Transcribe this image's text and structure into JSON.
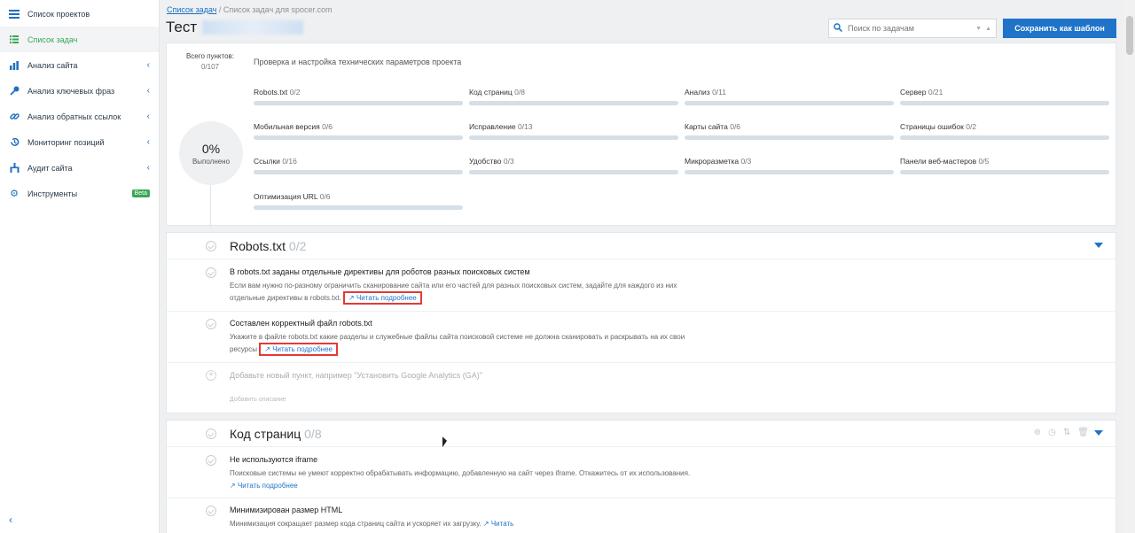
{
  "sidebar": {
    "items": [
      {
        "label": "Список проектов",
        "icon": "menu-icon"
      },
      {
        "label": "Список задач",
        "icon": "list-icon"
      },
      {
        "label": "Анализ сайта",
        "icon": "analysis-icon"
      },
      {
        "label": "Анализ ключевых фраз",
        "icon": "key-icon"
      },
      {
        "label": "Анализ обратных ссылок",
        "icon": "link-icon"
      },
      {
        "label": "Мониторинг позиций",
        "icon": "history-icon"
      },
      {
        "label": "Аудит сайта",
        "icon": "hierarchy-icon"
      },
      {
        "label": "Инструменты",
        "icon": "gear-icon"
      }
    ],
    "beta": "Beta",
    "active_color": "#3aa757"
  },
  "breadcrumb": {
    "link": "Список задач",
    "rest": " / Список задач для spocer.com"
  },
  "page_title": "Тест",
  "search": {
    "placeholder": "Поиск по задачам"
  },
  "save_button": "Сохранить как шаблон",
  "summary": {
    "total_label": "Всего пунктов:",
    "total_count": "0/107",
    "description": "Проверка и настройка технических параметров проекта",
    "percent": "0%",
    "done_label": "Выполнено",
    "categories": [
      {
        "name": "Robots.txt",
        "count": "0/2"
      },
      {
        "name": "Код страниц",
        "count": "0/8"
      },
      {
        "name": "Анализ",
        "count": "0/11"
      },
      {
        "name": "Сервер",
        "count": "0/21"
      },
      {
        "name": "Мобильная версия",
        "count": "0/6"
      },
      {
        "name": "Исправление",
        "count": "0/13"
      },
      {
        "name": "Карты сайта",
        "count": "0/6"
      },
      {
        "name": "Страницы ошибок",
        "count": "0/2"
      },
      {
        "name": "Ссылки",
        "count": "0/16"
      },
      {
        "name": "Удобство",
        "count": "0/3"
      },
      {
        "name": "Микроразметка",
        "count": "0/3"
      },
      {
        "name": "Панели веб-мастеров",
        "count": "0/5"
      },
      {
        "name": "Оптимизация URL",
        "count": "0/6"
      }
    ]
  },
  "robots": {
    "title": "Robots.txt",
    "count": "0/2",
    "tasks": [
      {
        "title": "В robots.txt заданы отдельные директивы для роботов разных поисковых систем",
        "desc": "Если вам нужно по-разному ограничить сканирование сайта или его частей для разных поисковых систем, задайте для каждого из них отдельные директивы в robots.txt.",
        "link": "Читать подробнее"
      },
      {
        "title": "Составлен корректный файл robots.txt",
        "desc": "Укажите в файле robots.txt какие разделы и служебные файлы сайта поисковой системе не должна сканировать и раскрывать на их свои ресурсы",
        "link": "Читать подробнее"
      }
    ],
    "add_placeholder": "Добавьте новый пункт, например \"Установить Google Analytics (GA)\"",
    "add_sub": "Добавить описание"
  },
  "codepage": {
    "title": "Код страниц",
    "count": "0/8",
    "tasks": [
      {
        "title": "Не используются iframe",
        "desc": "Поисковые системы не умеют корректно обрабатывать информацию, добавленную на сайт через iframe. Откажитесь от их использования.",
        "link": "Читать подробнее"
      },
      {
        "title": "Минимизирован размер HTML",
        "desc": "Минимизация сокращает размер кода страниц сайта и ускоряет их загрузку.",
        "link": "Читать"
      }
    ]
  },
  "colors": {
    "accent": "#1f73c9",
    "highlight": "#e53935"
  }
}
